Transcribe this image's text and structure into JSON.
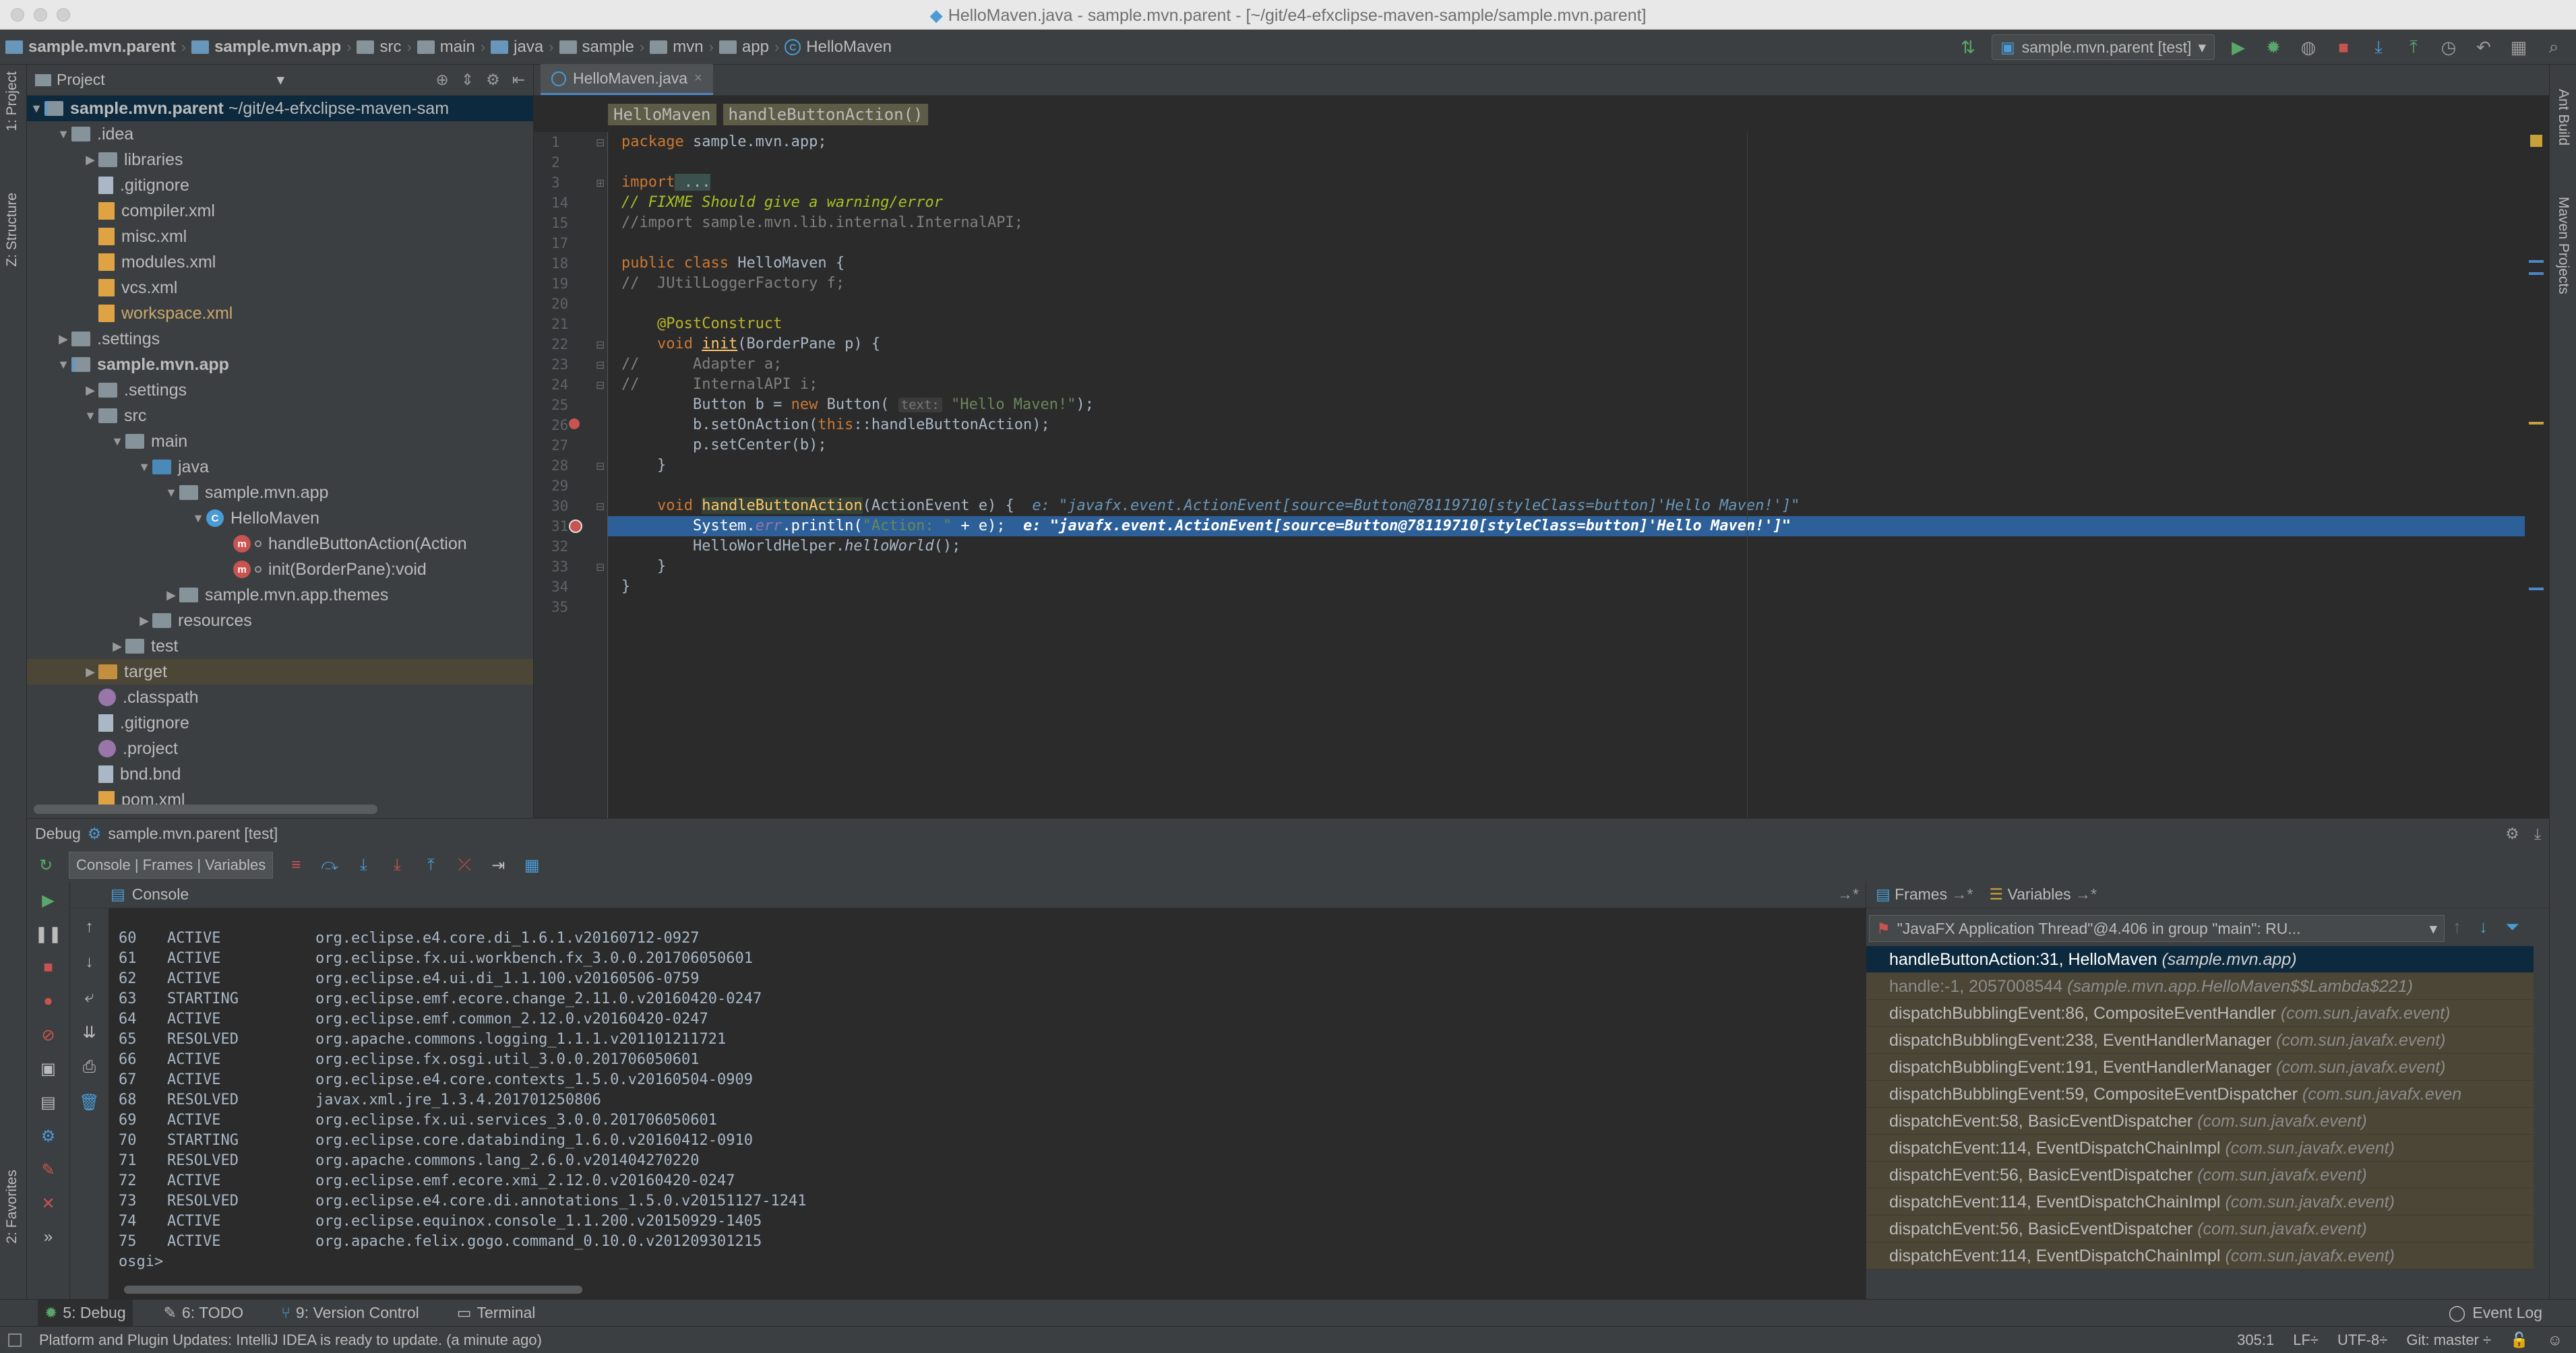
{
  "window": {
    "title": "HelloMaven.java - sample.mvn.parent - [~/git/e4-efxclipse-maven-sample/sample.mvn.parent]"
  },
  "navbar": {
    "crumbs": [
      "sample.mvn.parent",
      "sample.mvn.app",
      "src",
      "main",
      "java",
      "sample",
      "mvn",
      "app",
      "HelloMaven"
    ],
    "run_config": "sample.mvn.parent [test]"
  },
  "left_stripe": {
    "project_tab": "1: Project",
    "structure_tab": "Z: Structure",
    "favorites_tab": "2: Favorites"
  },
  "right_stripe": {
    "ant_tab": "Ant Build",
    "maven_tab": "Maven Projects"
  },
  "project": {
    "view_label": "Project",
    "tree": [
      {
        "label": "sample.mvn.parent",
        "extra": "~/git/e4-efxclipse-maven-sam"
      },
      {
        "label": ".idea"
      },
      {
        "label": "libraries"
      },
      {
        "label": ".gitignore"
      },
      {
        "label": "compiler.xml"
      },
      {
        "label": "misc.xml"
      },
      {
        "label": "modules.xml"
      },
      {
        "label": "vcs.xml"
      },
      {
        "label": "workspace.xml"
      },
      {
        "label": ".settings"
      },
      {
        "label": "sample.mvn.app"
      },
      {
        "label": ".settings"
      },
      {
        "label": "src"
      },
      {
        "label": "main"
      },
      {
        "label": "java"
      },
      {
        "label": "sample.mvn.app"
      },
      {
        "label": "HelloMaven"
      },
      {
        "label": "handleButtonAction(Action"
      },
      {
        "label": "init(BorderPane):void"
      },
      {
        "label": "sample.mvn.app.themes"
      },
      {
        "label": "resources"
      },
      {
        "label": "test"
      },
      {
        "label": "target"
      },
      {
        "label": ".classpath"
      },
      {
        "label": ".gitignore"
      },
      {
        "label": ".project"
      },
      {
        "label": "bnd.bnd"
      },
      {
        "label": "pom.xml"
      }
    ]
  },
  "editor": {
    "tab_label": "HelloMaven.java",
    "crumbs": [
      "HelloMaven",
      "handleButtonAction()"
    ],
    "line_numbers": [
      "1",
      "2",
      "3",
      "14",
      "15",
      "17",
      "18",
      "19",
      "20",
      "21",
      "22",
      "23",
      "24",
      "25",
      "26",
      "27",
      "28",
      "29",
      "30",
      "31",
      "32",
      "33",
      "34",
      "35"
    ],
    "lines": {
      "l1_kw": "package",
      "l1_rest": " sample.mvn.app;",
      "l3_kw": "import",
      "l3_rest": " ...",
      "l14": "// FIXME Should give a warning/error",
      "l15": "//import sample.mvn.lib.internal.InternalAPI;",
      "l18_kw": "public class",
      "l18_rest": " HelloMaven {",
      "l19": "//  JUtilLoggerFactory f;",
      "l21": "    @PostConstruct",
      "l22_kw": "    void",
      "l22_fn": "init",
      "l22_rest": "(BorderPane p) {",
      "l23": "//      Adapter a;",
      "l24": "//      InternalAPI i;",
      "l25_a": "        Button b = ",
      "l25_kw": "new",
      "l25_b": " Button(",
      "l25_hint": "text:",
      "l25_str": "\"Hello Maven!\"",
      "l25_c": ");",
      "l26_a": "        b.setOnAction(",
      "l26_kw": "this",
      "l26_b": "::handleButtonAction);",
      "l27": "        p.setCenter(b);",
      "l28": "    }",
      "l30_kw": "    void",
      "l30_fn": "handleButtonAction",
      "l30_rest": "(ActionEvent e) {",
      "l30_inline": "e: \"javafx.event.ActionEvent[source=Button@78119710[styleClass=button]'Hello Maven!']\"",
      "l31_a": "        System.",
      "l31_err": "err",
      "l31_b": ".println(",
      "l31_str": "\"Action: \"",
      "l31_c": " + e);",
      "l31_inline": "e: \"javafx.event.ActionEvent[source=Button@78119710[styleClass=button]'Hello Maven!']\"",
      "l32_a": "        HelloWorldHelper.",
      "l32_fn": "helloWorld",
      "l32_b": "();",
      "l33": "    }",
      "l34": "}"
    }
  },
  "debug": {
    "header_label": "Debug",
    "config": "sample.mvn.parent [test]",
    "tabs_label": "Console | Frames | Variables",
    "console_label": "Console",
    "console_rows": [
      {
        "id": "60",
        "state": "ACTIVE",
        "bundle": "org.eclipse.e4.core.di_1.6.1.v20160712-0927"
      },
      {
        "id": "61",
        "state": "ACTIVE",
        "bundle": "org.eclipse.fx.ui.workbench.fx_3.0.0.201706050601"
      },
      {
        "id": "62",
        "state": "ACTIVE",
        "bundle": "org.eclipse.e4.ui.di_1.1.100.v20160506-0759"
      },
      {
        "id": "63",
        "state": "STARTING",
        "bundle": "org.eclipse.emf.ecore.change_2.11.0.v20160420-0247"
      },
      {
        "id": "64",
        "state": "ACTIVE",
        "bundle": "org.eclipse.emf.common_2.12.0.v20160420-0247"
      },
      {
        "id": "65",
        "state": "RESOLVED",
        "bundle": "org.apache.commons.logging_1.1.1.v201101211721"
      },
      {
        "id": "66",
        "state": "ACTIVE",
        "bundle": "org.eclipse.fx.osgi.util_3.0.0.201706050601"
      },
      {
        "id": "67",
        "state": "ACTIVE",
        "bundle": "org.eclipse.e4.core.contexts_1.5.0.v20160504-0909"
      },
      {
        "id": "68",
        "state": "RESOLVED",
        "bundle": "javax.xml.jre_1.3.4.201701250806"
      },
      {
        "id": "69",
        "state": "ACTIVE",
        "bundle": "org.eclipse.fx.ui.services_3.0.0.201706050601"
      },
      {
        "id": "70",
        "state": "STARTING",
        "bundle": "org.eclipse.core.databinding_1.6.0.v20160412-0910"
      },
      {
        "id": "71",
        "state": "RESOLVED",
        "bundle": "org.apache.commons.lang_2.6.0.v201404270220"
      },
      {
        "id": "72",
        "state": "ACTIVE",
        "bundle": "org.eclipse.emf.ecore.xmi_2.12.0.v20160420-0247"
      },
      {
        "id": "73",
        "state": "RESOLVED",
        "bundle": "org.eclipse.e4.core.di.annotations_1.5.0.v20151127-1241"
      },
      {
        "id": "74",
        "state": "ACTIVE",
        "bundle": "org.eclipse.equinox.console_1.1.200.v20150929-1405"
      },
      {
        "id": "75",
        "state": "ACTIVE",
        "bundle": "org.apache.felix.gogo.command_0.10.0.v201209301215"
      }
    ],
    "prompt": "osgi>",
    "frames_tab": "Frames",
    "variables_tab": "Variables",
    "thread": "\"JavaFX Application Thread\"@4.406 in group \"main\": RU...",
    "frames": [
      {
        "method": "handleButtonAction:31, HelloMaven",
        "pkg": "(sample.mvn.app)"
      },
      {
        "method": "handle:-1, 2057008544",
        "pkg": "(sample.mvn.app.HelloMaven$$Lambda$221)"
      },
      {
        "method": "dispatchBubblingEvent:86, CompositeEventHandler",
        "pkg": "(com.sun.javafx.event)"
      },
      {
        "method": "dispatchBubblingEvent:238, EventHandlerManager",
        "pkg": "(com.sun.javafx.event)"
      },
      {
        "method": "dispatchBubblingEvent:191, EventHandlerManager",
        "pkg": "(com.sun.javafx.event)"
      },
      {
        "method": "dispatchBubblingEvent:59, CompositeEventDispatcher",
        "pkg": "(com.sun.javafx.even"
      },
      {
        "method": "dispatchEvent:58, BasicEventDispatcher",
        "pkg": "(com.sun.javafx.event)"
      },
      {
        "method": "dispatchEvent:114, EventDispatchChainImpl",
        "pkg": "(com.sun.javafx.event)"
      },
      {
        "method": "dispatchEvent:56, BasicEventDispatcher",
        "pkg": "(com.sun.javafx.event)"
      },
      {
        "method": "dispatchEvent:114, EventDispatchChainImpl",
        "pkg": "(com.sun.javafx.event)"
      },
      {
        "method": "dispatchEvent:56, BasicEventDispatcher",
        "pkg": "(com.sun.javafx.event)"
      },
      {
        "method": "dispatchEvent:114, EventDispatchChainImpl",
        "pkg": "(com.sun.javafx.event)"
      }
    ]
  },
  "bottom_tabs": {
    "debug": "5: Debug",
    "todo": "6: TODO",
    "vcs": "9: Version Control",
    "terminal": "Terminal",
    "event_log": "Event Log"
  },
  "status": {
    "message": "Platform and Plugin Updates: IntelliJ IDEA is ready to update. (a minute ago)",
    "position": "305:1",
    "line_sep": "LF÷",
    "encoding": "UTF-8÷",
    "git": "Git: master ÷"
  },
  "colors": {
    "background": "#2b2b2b",
    "panel": "#3c3f41",
    "selection": "#2d6099",
    "keyword": "#cc7832",
    "string": "#6a8759",
    "function": "#ffc66d"
  }
}
